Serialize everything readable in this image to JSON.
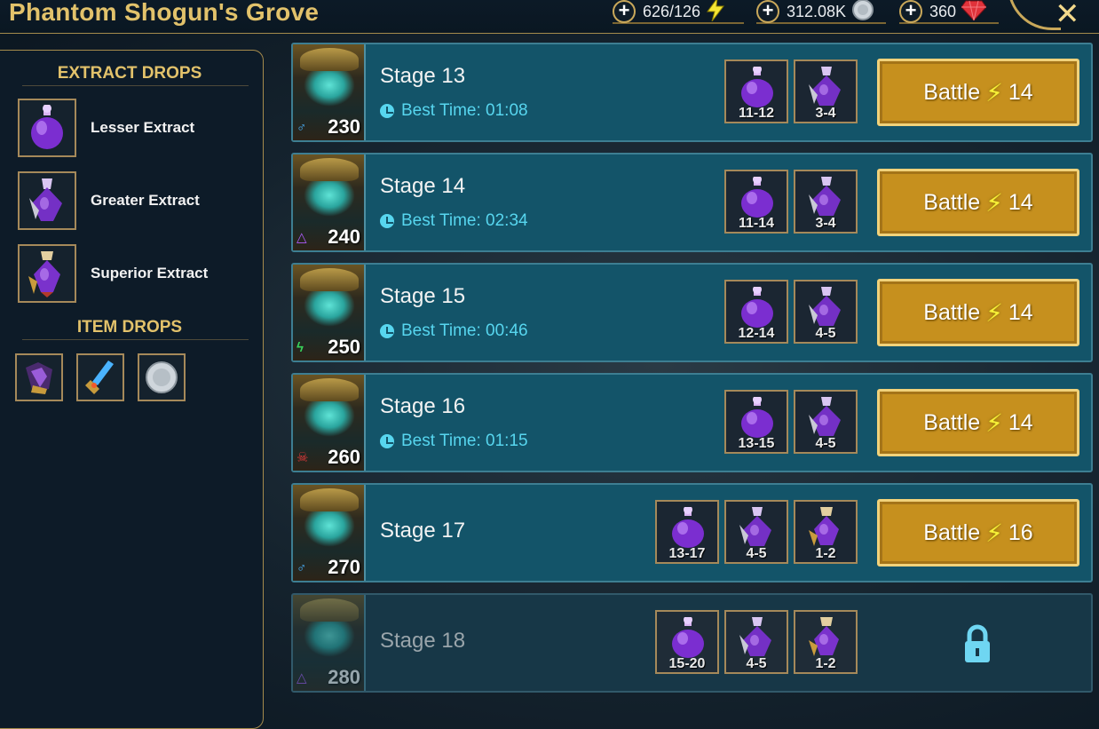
{
  "header": {
    "title": "Phantom Shogun's Grove",
    "resources": [
      {
        "value": "626/126",
        "icon": "energy-bolt-icon",
        "color": "#f5e634"
      },
      {
        "value": "312.08K",
        "icon": "silver-coin-icon",
        "color": "#cfd6dc"
      },
      {
        "value": "360",
        "icon": "ruby-gem-icon",
        "color": "#e0323a"
      }
    ],
    "add_symbol": "+",
    "close_symbol": "✕"
  },
  "left_panel": {
    "extract_heading": "EXTRACT DROPS",
    "extracts": [
      {
        "label": "Lesser Extract",
        "icon": "lesser-extract-icon"
      },
      {
        "label": "Greater Extract",
        "icon": "greater-extract-icon"
      },
      {
        "label": "Superior Extract",
        "icon": "superior-extract-icon"
      }
    ],
    "item_heading": "ITEM DROPS",
    "items": [
      {
        "icon": "artifact-gauntlet-icon"
      },
      {
        "icon": "artifact-weapon-icon"
      },
      {
        "icon": "silver-coin-icon"
      }
    ]
  },
  "stages": [
    {
      "title": "Stage 13",
      "best_time": "Best Time: 01:08",
      "power": "230",
      "affinity": "magic",
      "drops": [
        "11-12",
        "3-4"
      ],
      "battle_label": "Battle",
      "energy": "14",
      "locked": false
    },
    {
      "title": "Stage 14",
      "best_time": "Best Time: 02:34",
      "power": "240",
      "affinity": "spirit",
      "drops": [
        "11-14",
        "3-4"
      ],
      "battle_label": "Battle",
      "energy": "14",
      "locked": false
    },
    {
      "title": "Stage 15",
      "best_time": "Best Time: 00:46",
      "power": "250",
      "affinity": "force",
      "drops": [
        "12-14",
        "4-5"
      ],
      "battle_label": "Battle",
      "energy": "14",
      "locked": false
    },
    {
      "title": "Stage 16",
      "best_time": "Best Time: 01:15",
      "power": "260",
      "affinity": "void",
      "drops": [
        "13-15",
        "4-5"
      ],
      "battle_label": "Battle",
      "energy": "14",
      "locked": false
    },
    {
      "title": "Stage 17",
      "best_time": "",
      "power": "270",
      "affinity": "magic",
      "drops": [
        "13-17",
        "4-5",
        "1-2"
      ],
      "battle_label": "Battle",
      "energy": "16",
      "locked": false
    },
    {
      "title": "Stage 18",
      "best_time": "",
      "power": "280",
      "affinity": "spirit",
      "drops": [
        "15-20",
        "4-5",
        "1-2"
      ],
      "battle_label": "",
      "energy": "",
      "locked": true
    }
  ]
}
